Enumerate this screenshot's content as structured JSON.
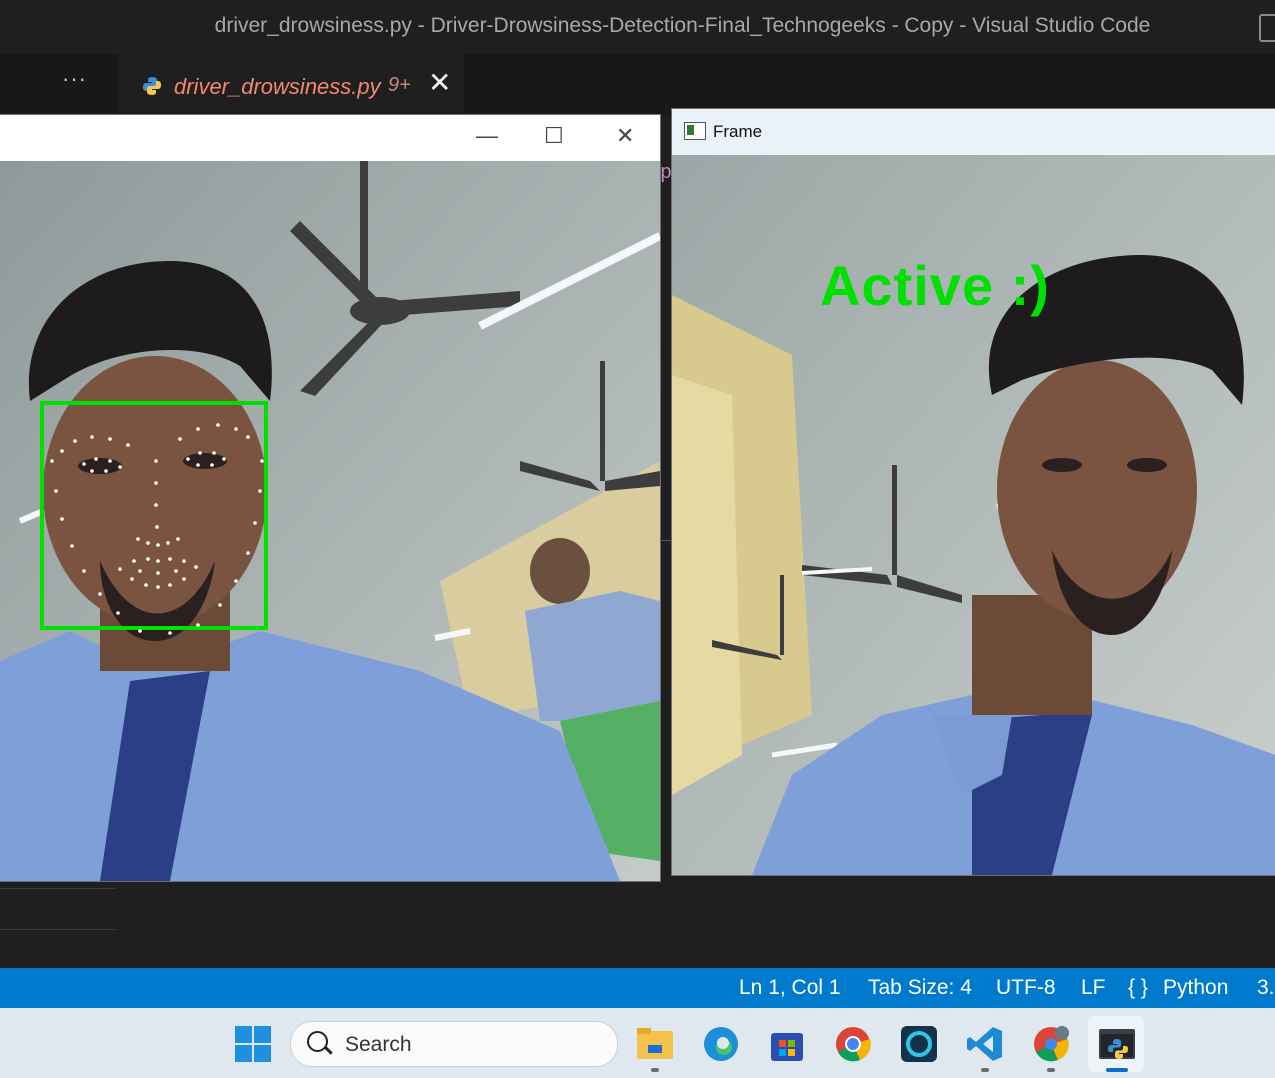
{
  "titlebar": {
    "title": "driver_drowsiness.py - Driver-Drowsiness-Detection-Final_Technogeeks - Copy - Visual Studio Code"
  },
  "tabbar": {
    "more": "···",
    "tab_name": "driver_drowsiness.py",
    "tab_badge": "9+",
    "tab_close": "✕"
  },
  "left_window": {
    "minimize": "—",
    "maximize": "☐",
    "close": "✕"
  },
  "right_window": {
    "title": "Frame",
    "overlay_text": "Active :)"
  },
  "statusbar": {
    "position": "Ln 1, Col 1",
    "tab_size": "Tab Size: 4",
    "encoding": "UTF-8",
    "eol": "LF",
    "language": "Python",
    "version": "3."
  },
  "taskbar": {
    "search_placeholder": "Search"
  },
  "colors": {
    "status_blue": "#007acc",
    "detect_green": "#00e000",
    "tab_text": "#f48771"
  }
}
